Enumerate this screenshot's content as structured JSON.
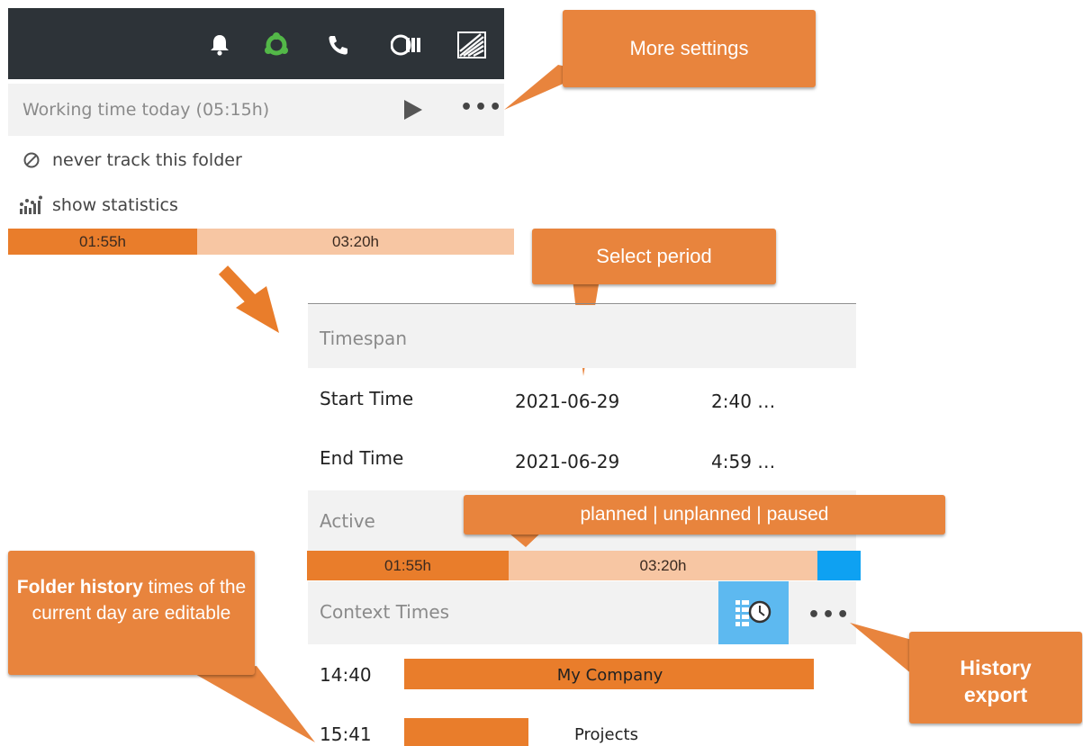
{
  "toolbar": {
    "icons": [
      "bell-icon",
      "sync-icon",
      "phone-icon",
      "coin-stack-icon",
      "stripes-logo-icon"
    ]
  },
  "tracker": {
    "working_time_label": "Working time today (05:15h)",
    "menu": [
      {
        "icon": "no-entry-icon",
        "label": "never track this folder"
      },
      {
        "icon": "statistics-icon",
        "label": "show statistics"
      }
    ],
    "bar": {
      "planned": "01:55h",
      "unplanned": "03:20h"
    }
  },
  "panel": {
    "timespan_label": "Timespan",
    "start": {
      "label": "Start Time",
      "date": "2021-06-29",
      "time": "2:40 …"
    },
    "end": {
      "label": "End Time",
      "date": "2021-06-29",
      "time": "4:59 …"
    },
    "active_label": "Active",
    "bar": {
      "planned": "01:55h",
      "unplanned": "03:20h",
      "planned_fraction": 0.365,
      "unplanned_fraction": 0.557,
      "paused_fraction": 0.078
    },
    "context_label": "Context Times",
    "context_rows": [
      {
        "time": "14:40",
        "label": "My Company",
        "fill": 0.99
      },
      {
        "time": "15:41",
        "label": "Projects",
        "fill": 0.3
      }
    ]
  },
  "callouts": {
    "more_settings": "More settings",
    "select_period": "Select period",
    "states": "planned | unplanned | paused",
    "folder_history_bold": "Folder history",
    "folder_history_rest": " times of the current day are editable",
    "history_export_line1": "History",
    "history_export_line2": "export"
  },
  "colors": {
    "planned": "#e97d2b",
    "unplanned": "#f7c6a3",
    "paused": "#0ea1f2",
    "callout": "#e8843d",
    "toolbar": "#2d3338"
  }
}
